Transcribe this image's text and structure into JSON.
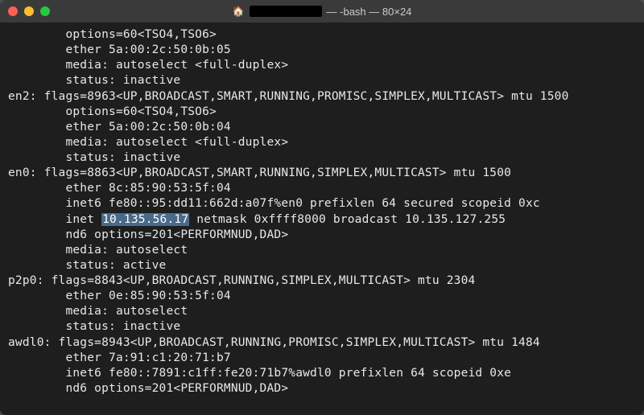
{
  "window": {
    "title_prefix": "",
    "title_suffix": " — -bash — 80×24",
    "home_icon": "🏠"
  },
  "highlight": {
    "ip": "10.135.56.17"
  },
  "lines": {
    "l0": "        options=60<TSO4,TSO6>",
    "l1": "        ether 5a:00:2c:50:0b:05",
    "l2": "        media: autoselect <full-duplex>",
    "l3": "        status: inactive",
    "l4": "en2: flags=8963<UP,BROADCAST,SMART,RUNNING,PROMISC,SIMPLEX,MULTICAST> mtu 1500",
    "l5": "        options=60<TSO4,TSO6>",
    "l6": "        ether 5a:00:2c:50:0b:04",
    "l7": "        media: autoselect <full-duplex>",
    "l8": "        status: inactive",
    "l9": "en0: flags=8863<UP,BROADCAST,SMART,RUNNING,SIMPLEX,MULTICAST> mtu 1500",
    "l10": "        ether 8c:85:90:53:5f:04",
    "l11": "        inet6 fe80::95:dd11:662d:a07f%en0 prefixlen 64 secured scopeid 0xc",
    "l12a": "        inet ",
    "l12b": " netmask 0xffff8000 broadcast 10.135.127.255",
    "l13": "        nd6 options=201<PERFORMNUD,DAD>",
    "l14": "        media: autoselect",
    "l15": "        status: active",
    "l16": "p2p0: flags=8843<UP,BROADCAST,RUNNING,SIMPLEX,MULTICAST> mtu 2304",
    "l17": "        ether 0e:85:90:53:5f:04",
    "l18": "        media: autoselect",
    "l19": "        status: inactive",
    "l20": "awdl0: flags=8943<UP,BROADCAST,RUNNING,PROMISC,SIMPLEX,MULTICAST> mtu 1484",
    "l21": "        ether 7a:91:c1:20:71:b7",
    "l22": "        inet6 fe80::7891:c1ff:fe20:71b7%awdl0 prefixlen 64 scopeid 0xe",
    "l23": "        nd6 options=201<PERFORMNUD,DAD>"
  }
}
